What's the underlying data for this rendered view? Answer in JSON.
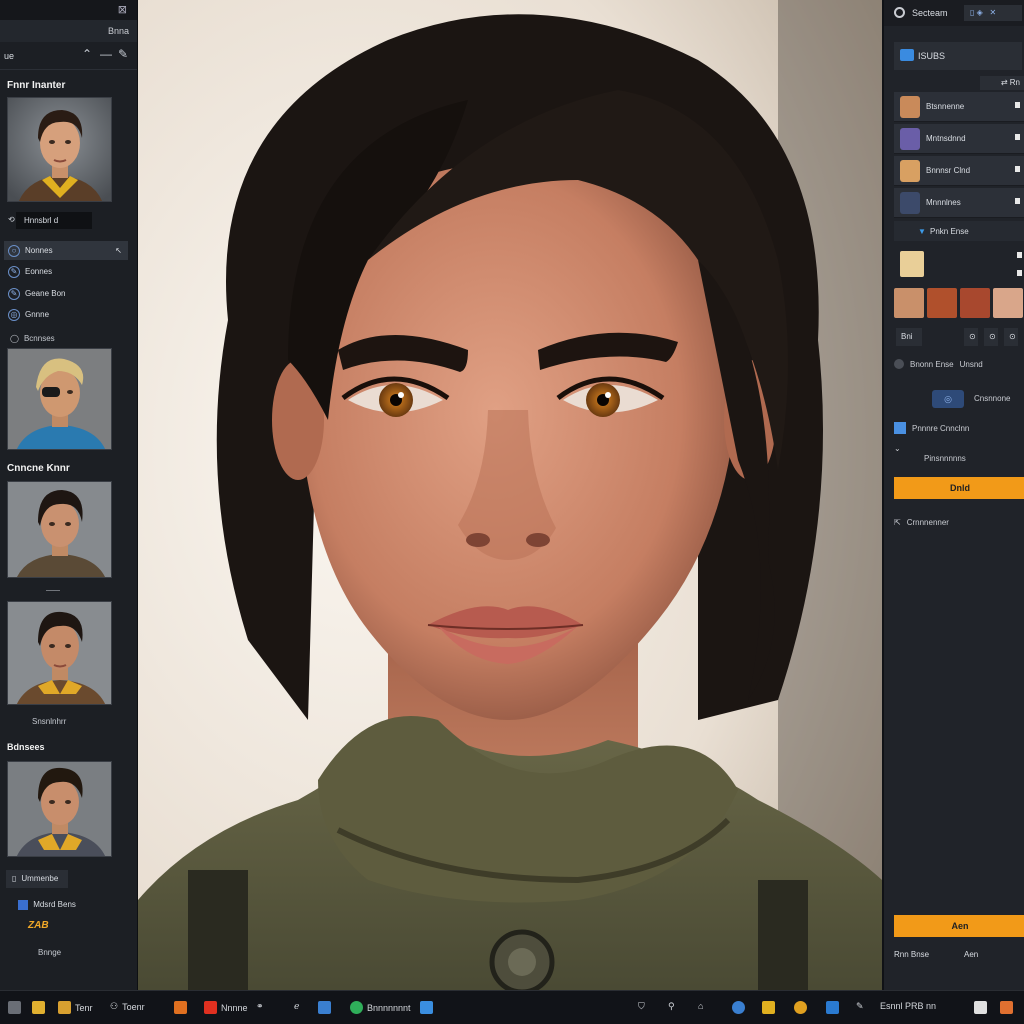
{
  "left_panel": {
    "top_label": "Bnna",
    "toolbar_label": "ue",
    "section1_title": "Fnnr Inanter",
    "name_field": "Hnnsbrl d",
    "menu": [
      "Nonnes",
      "Eonnes",
      "Geane Bon",
      "Gnnne"
    ],
    "section2_caption": "Bcnnses",
    "section3_title": "Cnncne Knnr",
    "caption_a": "Snsnlnhrr",
    "section4_title": "Bdnsees",
    "button_label": "Ummenbe",
    "logo_text": "Mdsrd Bens",
    "yellow_logo": "ZAB",
    "bottom_label": "Bnnge"
  },
  "right_panel": {
    "top_title": "Secteam",
    "head_title": "ISUBS",
    "sub_label": "Rn",
    "layers": [
      {
        "label": "Btsnnenne",
        "color": "#c98a5a"
      },
      {
        "label": "Mntnsdnnd",
        "color": "#6a5ea8"
      },
      {
        "label": "Bnnnsr Clnd",
        "color": "#d8a062"
      },
      {
        "label": "Mnnnlnes",
        "color": "#3c4a6a"
      }
    ],
    "expand_label": "Pnkn Ense",
    "thumb_colors": [
      "#c9906a",
      "#b0502c",
      "#a8482e",
      "#d9a68a"
    ],
    "ctrl_a": "Bni",
    "radio_label": "Bnonn Ense",
    "radio_value": "Unsnd",
    "tag_label": "Cnsnnone",
    "checkbox_label": "Pnnnre Cnnclnn",
    "sub_option": "Pinsnnnnns",
    "primary_button": "Dnld",
    "export_label": "Crnnnenner",
    "secondary_button": "Aen",
    "footer_left": "Rnn Bnse",
    "footer_right": "Aen"
  },
  "taskbar": {
    "items": [
      "Tenr",
      "Toenr",
      "Nnnne",
      "Bnnnnnnnt"
    ],
    "clock": "Esnnl PRB nn"
  },
  "colors": {
    "accent_orange": "#f29a18",
    "accent_blue": "#3d9be9",
    "panel_bg": "#202329"
  }
}
